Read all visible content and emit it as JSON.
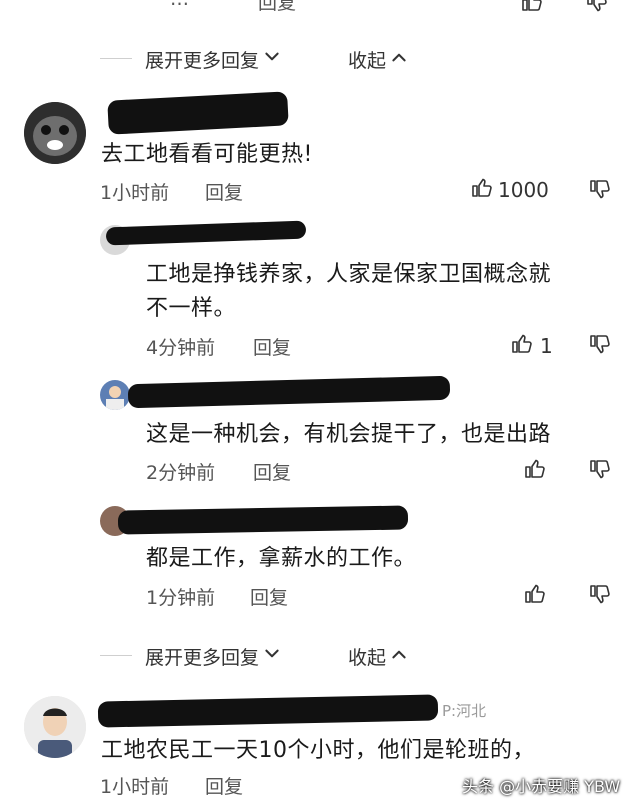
{
  "top_partial": {
    "time": "…",
    "reply": "回复"
  },
  "expand_1": {
    "expand_label": "展开更多回复",
    "collapse_label": "收起"
  },
  "comment_main": {
    "text": "去工地看看可能更热!",
    "time": "1小时前",
    "reply": "回复",
    "likes": "1000"
  },
  "reply_1": {
    "text_line1": "工地是挣钱养家，人家是保家卫国概念就",
    "text_line2": "不一样。",
    "time": "4分钟前",
    "reply": "回复",
    "likes": "1"
  },
  "reply_2": {
    "text": "这是一种机会，有机会提干了，也是出路",
    "time": "2分钟前",
    "reply": "回复"
  },
  "reply_3": {
    "text": "都是工作，拿薪水的工作。",
    "time": "1分钟前",
    "reply": "回复"
  },
  "expand_2": {
    "expand_label": "展开更多回复",
    "collapse_label": "收起"
  },
  "comment_last": {
    "location": "P:河北",
    "text": "工地农民工一天10个小时，他们是轮班的，",
    "time": "1小时前",
    "reply": "回复"
  },
  "watermark": {
    "text": "头条 @小赤要赚 YBW"
  },
  "icons": [
    "thumb-up-icon",
    "thumb-down-icon",
    "chevron-down-icon",
    "chevron-up-icon"
  ]
}
